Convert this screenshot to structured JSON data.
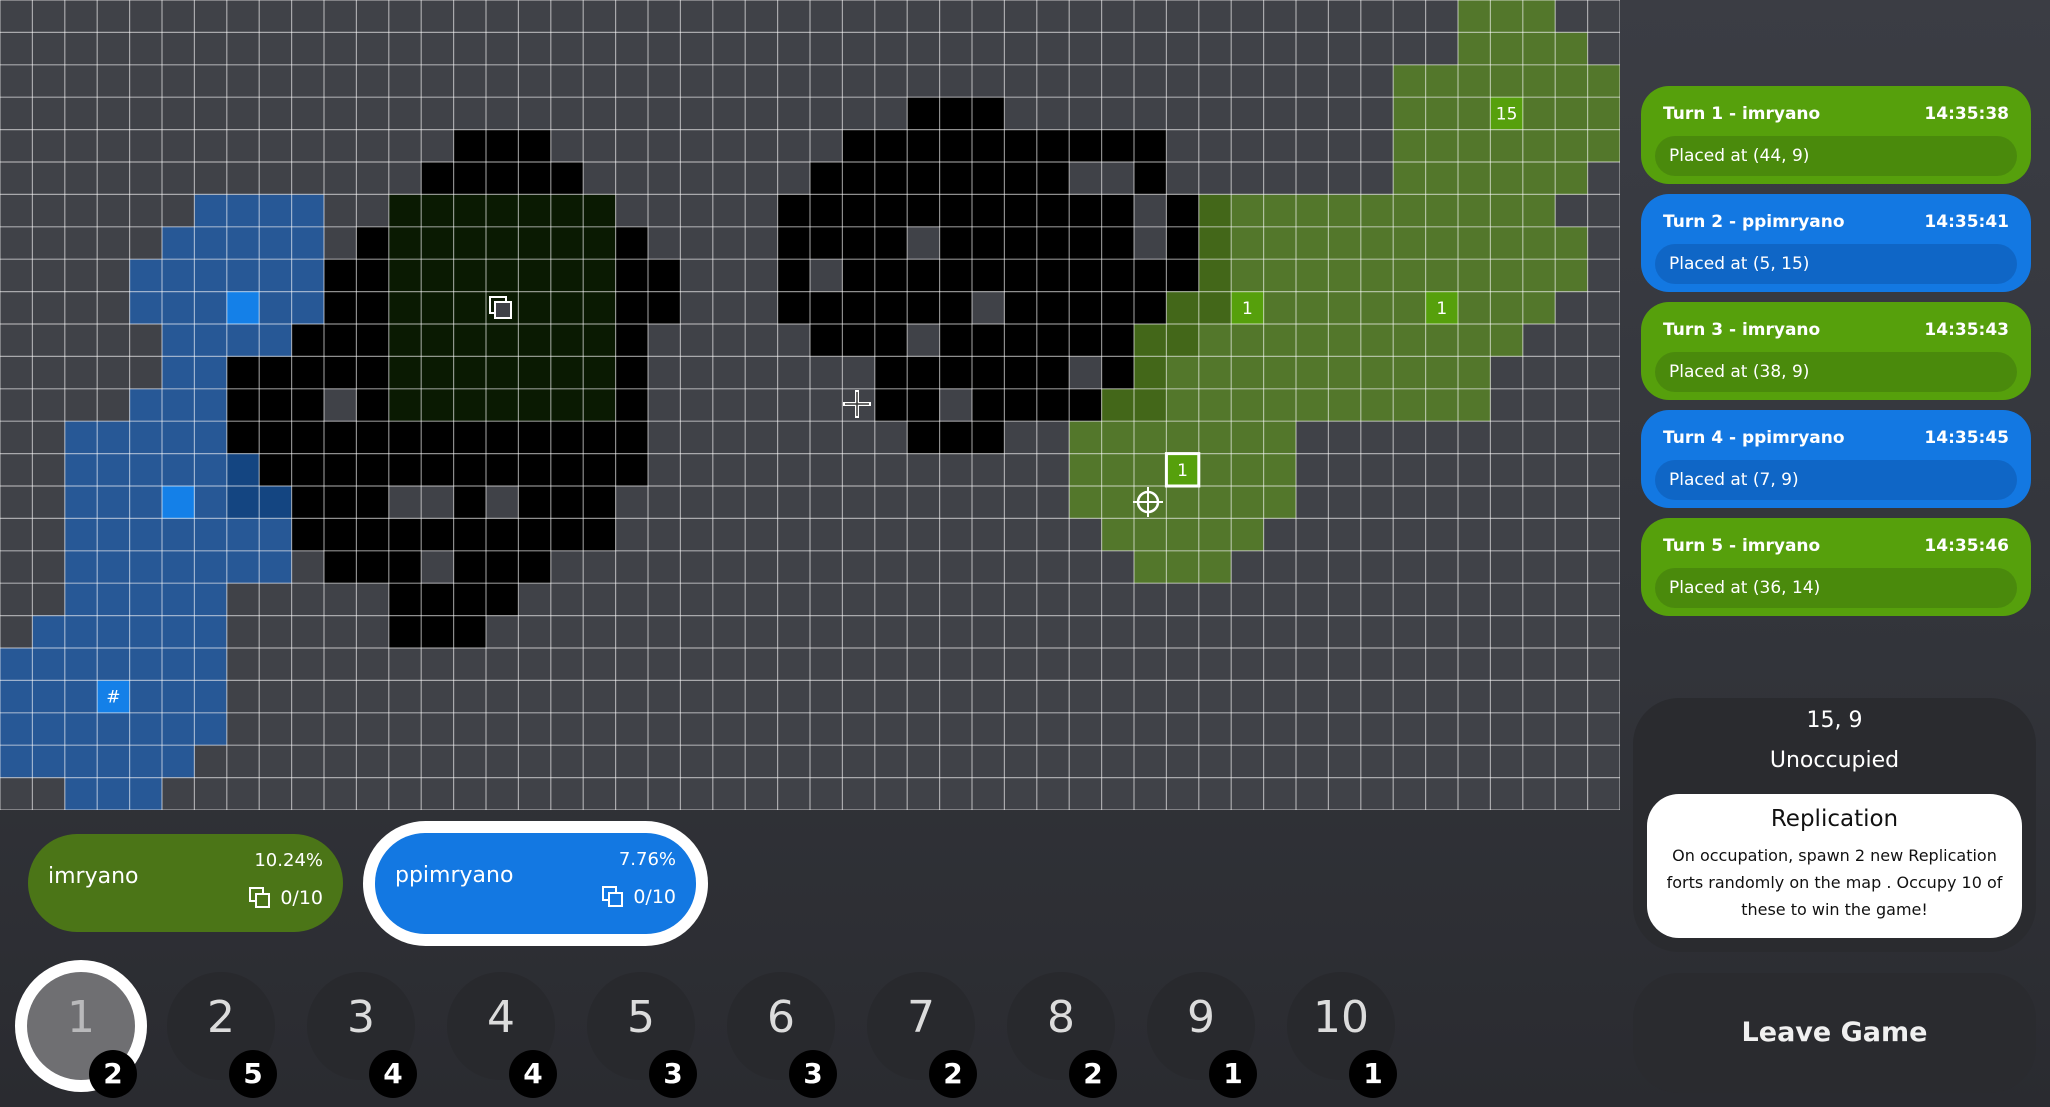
{
  "board": {
    "selected_cell": "15, 9"
  },
  "tile_labels": [
    {
      "text": "15",
      "team": "green"
    },
    {
      "text": "1",
      "team": "green"
    },
    {
      "text": "1",
      "team": "green"
    },
    {
      "text": "1",
      "team": "green"
    },
    {
      "text": "#",
      "team": "blue"
    }
  ],
  "turn_log": [
    {
      "title": "Turn 1 - imryano",
      "time": "14:35:38",
      "detail": "Placed at (44, 9)",
      "color": "#56a00c"
    },
    {
      "title": "Turn 2 - ppimryano",
      "time": "14:35:41",
      "detail": "Placed at (5, 15)",
      "color": "#1378e2"
    },
    {
      "title": "Turn 3 - imryano",
      "time": "14:35:43",
      "detail": "Placed at (38, 9)",
      "color": "#56a00c"
    },
    {
      "title": "Turn 4 - ppimryano",
      "time": "14:35:45",
      "detail": "Placed at (7, 9)",
      "color": "#1378e2"
    },
    {
      "title": "Turn 5 - imryano",
      "time": "14:35:46",
      "detail": "Placed at (36, 14)",
      "color": "#56a00c"
    }
  ],
  "info": {
    "coord": "15, 9",
    "status": "Unoccupied",
    "card_title": "Replication",
    "card_text": "On occupation, spawn 2 new Replication forts randomly on the map . Occupy 10 of these to win the game!"
  },
  "players": [
    {
      "name": "imryano",
      "percent": "10.24%",
      "forts": "0/10",
      "color": "#4b7517"
    },
    {
      "name": "ppimryano",
      "percent": "7.76%",
      "forts": "0/10",
      "color": "#1378e2"
    }
  ],
  "hotbar": [
    {
      "num": "1",
      "count": "2"
    },
    {
      "num": "2",
      "count": "5"
    },
    {
      "num": "3",
      "count": "4"
    },
    {
      "num": "4",
      "count": "4"
    },
    {
      "num": "5",
      "count": "3"
    },
    {
      "num": "6",
      "count": "3"
    },
    {
      "num": "7",
      "count": "2"
    },
    {
      "num": "8",
      "count": "2"
    },
    {
      "num": "9",
      "count": "1"
    },
    {
      "num": "10",
      "count": "1"
    }
  ],
  "leave_button": "Leave Game",
  "icons": {
    "fort": "fort-icon",
    "cursor": "crosshair-cursor-icon",
    "target": "target-reticle-icon"
  }
}
